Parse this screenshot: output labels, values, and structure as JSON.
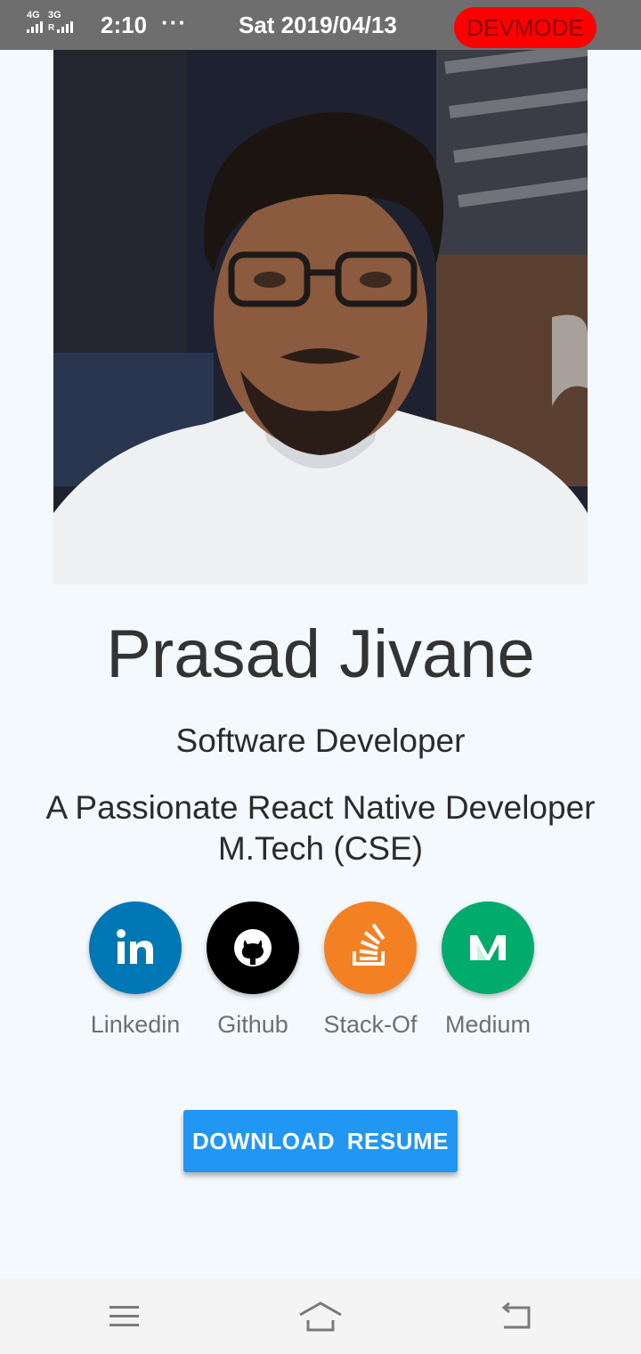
{
  "status_bar": {
    "network_1": "4G",
    "network_2": "3G",
    "network_2_sub": "R",
    "time": "2:10",
    "more": "···",
    "date": "Sat 2019/04/13",
    "devmode": "DEVMODE",
    "devmode_color": "#ff0000"
  },
  "profile": {
    "name": "Prasad Jivane",
    "role": "Software Developer",
    "description_line1": "A Passionate React Native Developer",
    "description_line2": "M.Tech (CSE)"
  },
  "socials": [
    {
      "label": "Linkedin",
      "icon": "linkedin-icon",
      "color": "#0077b5"
    },
    {
      "label": "Github",
      "icon": "github-icon",
      "color": "#000000"
    },
    {
      "label": "Stack-Of",
      "icon": "stackoverflow-icon",
      "color": "#f48024"
    },
    {
      "label": "Medium",
      "icon": "medium-icon",
      "color": "#00ab6c"
    }
  ],
  "download_button": {
    "label": "DOWNLOAD  RESUME",
    "color": "#2196f3"
  },
  "nav_bar": {
    "menu_icon": "menu-icon",
    "home_icon": "home-icon",
    "back_icon": "back-icon"
  }
}
